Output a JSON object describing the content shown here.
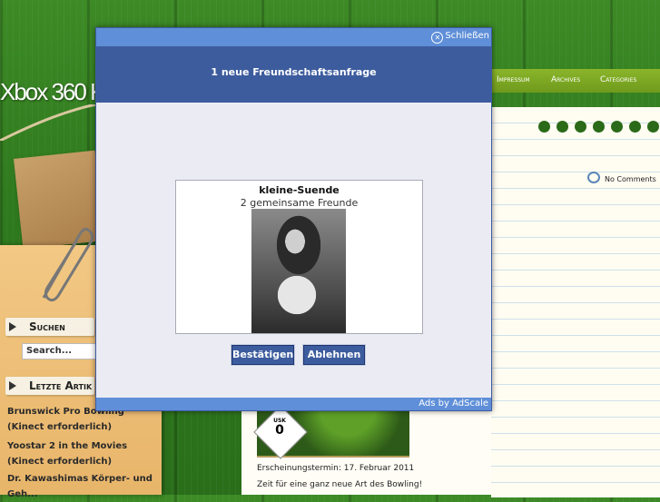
{
  "site": {
    "title": "Xbox 360 K",
    "nav": [
      "Impressum",
      "Archives",
      "Categories"
    ],
    "comments": "No Comments",
    "sidebar": {
      "search_heading": "Suchen",
      "search_placeholder": "Search...",
      "recent_heading": "Letzte Artik",
      "recent_links": [
        "Brunswick Pro Bowling (Kinect erforderlich)",
        "Yoostar 2 in the Movies (Kinect erforderlich)",
        "Dr. Kawashimas Körper- und Geh..."
      ]
    },
    "post": {
      "usk_label": "USK",
      "usk_rating": "0",
      "release": "Erscheinungstermin: 17. Februar 2011",
      "teaser": "Zeit für eine ganz neue Art des Bowling!"
    }
  },
  "modal": {
    "close_label": "Schließen",
    "title": "1 neue Freundschaftsanfrage",
    "friend_name": "kleine-Suende",
    "mutual_friends": "2 gemeinsame Freunde",
    "confirm_label": "Bestätigen",
    "decline_label": "Ablehnen",
    "ads_text": "Ads by AdScale"
  },
  "colors": {
    "modal_header": "#3d5c9e",
    "modal_bar": "#5f8fd8",
    "nav_green": "#7ea625"
  }
}
